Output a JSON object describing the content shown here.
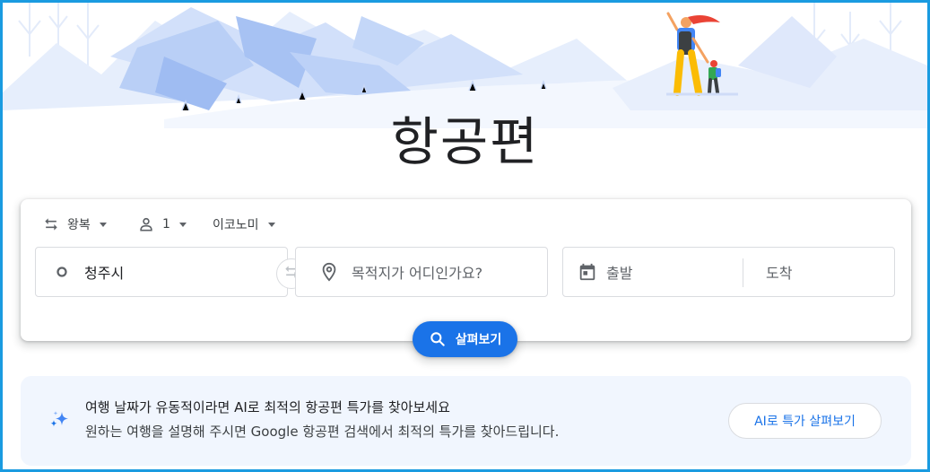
{
  "page": {
    "title": "항공편"
  },
  "search": {
    "trip_type": "왕복",
    "passengers": "1",
    "cabin_class": "이코노미",
    "origin": "청주시",
    "destination_placeholder": "목적지가 어디인가요?",
    "depart_placeholder": "출발",
    "return_placeholder": "도착",
    "explore_label": "살펴보기"
  },
  "ai_banner": {
    "headline": "여행 날짜가 유동적이라면 AI로 최적의 항공편 특가를 찾아보세요",
    "description": "원하는 여행을 설명해 주시면 Google 항공편 검색에서 최적의 특가를 찾아드립니다.",
    "button_label": "AI로 특가 살펴보기"
  },
  "icons": {
    "trip_type": "swap-arrows-icon",
    "passengers": "person-icon",
    "origin": "circle-icon",
    "destination": "location-pin-icon",
    "date": "calendar-icon",
    "swap": "swap-arrows-icon",
    "search": "search-icon",
    "ai": "sparkle-icon"
  },
  "colors": {
    "accent": "#1a73e8",
    "frame": "#1a9be0",
    "banner_bg": "#f1f6fe",
    "hero_light": "#dbe6fb",
    "hero_mid": "#aec7f5"
  }
}
